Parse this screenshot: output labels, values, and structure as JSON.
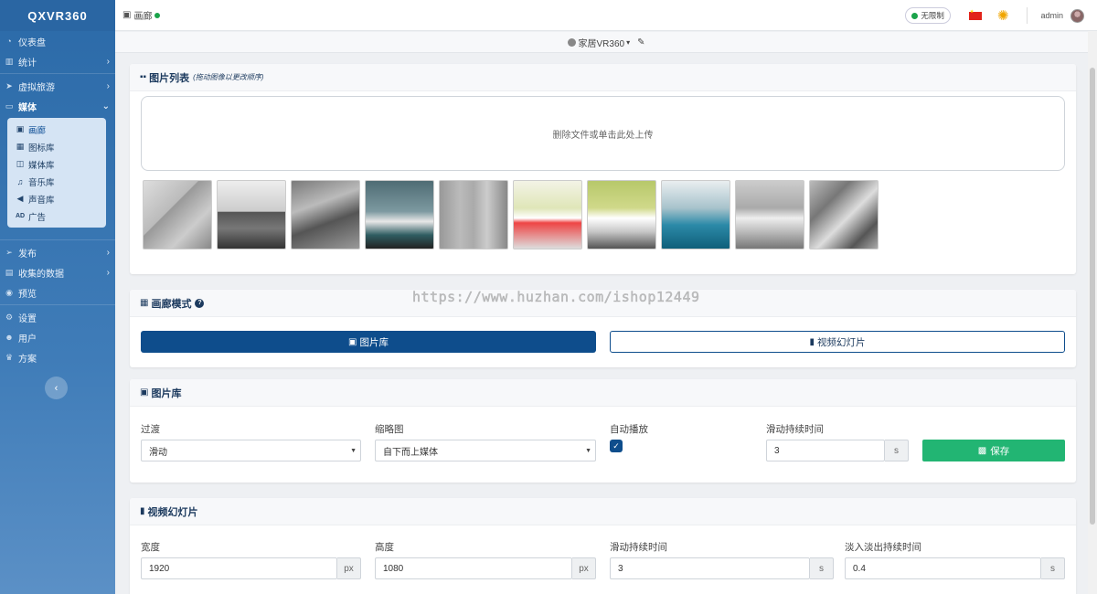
{
  "brand": "QXVR360",
  "sidebar": {
    "items": [
      {
        "label": "仪表盘",
        "icon": "dashboard-icon",
        "glyph": "◔",
        "chevron": false
      },
      {
        "label": "统计",
        "icon": "stats-icon",
        "glyph": "▥",
        "chevron": true
      },
      {
        "label": "虚拟旅游",
        "icon": "tour-icon",
        "glyph": "➤",
        "chevron": true
      },
      {
        "label": "媒体",
        "icon": "monitor-icon",
        "glyph": "▭",
        "chevron": true,
        "active": true
      }
    ],
    "submenu": [
      {
        "label": "画廊",
        "icon": "gallery-icon",
        "glyph": "▣"
      },
      {
        "label": "图标库",
        "icon": "icon-library-icon",
        "glyph": "▦"
      },
      {
        "label": "媒体库",
        "icon": "media-library-icon",
        "glyph": "◫"
      },
      {
        "label": "音乐库",
        "icon": "music-icon",
        "glyph": "♫"
      },
      {
        "label": "声音库",
        "icon": "volume-icon",
        "glyph": "◀)"
      },
      {
        "label": "广告",
        "icon": "ad-icon",
        "glyph": "AD"
      }
    ],
    "items2": [
      {
        "label": "发布",
        "icon": "publish-icon",
        "glyph": "➢",
        "chevron": true
      },
      {
        "label": "收集的数据",
        "icon": "data-icon",
        "glyph": "▤",
        "chevron": true
      },
      {
        "label": "预览",
        "icon": "eye-icon",
        "glyph": "◉",
        "chevron": false
      },
      {
        "label": "设置",
        "icon": "gears-icon",
        "glyph": "⚙",
        "chevron": false
      },
      {
        "label": "用户",
        "icon": "users-icon",
        "glyph": "👥",
        "chevron": false
      },
      {
        "label": "方案",
        "icon": "crown-icon",
        "glyph": "♛",
        "chevron": false
      }
    ]
  },
  "topbar": {
    "page_title": "画廊",
    "plan_badge": "无限制",
    "username": "admin"
  },
  "subbar": {
    "tour_name": "家居VR360"
  },
  "image_list": {
    "title": "图片列表",
    "hint": "(拖动图像以更改顺序)",
    "dropzone_text": "删除文件或单击此处上传",
    "thumb_count": 10
  },
  "gallery_mode": {
    "title": "画廊模式",
    "btn_images": "图片库",
    "btn_video": "视频幻灯片"
  },
  "image_gallery": {
    "title": "图片库",
    "transition_label": "过渡",
    "transition_value": "滑动",
    "thumbnails_label": "缩略图",
    "thumbnails_value": "自下而上媒体",
    "autoplay_label": "自动播放",
    "slide_duration_label": "滑动持续时间",
    "slide_duration_value": "3",
    "unit_s": "s",
    "save_label": "保存"
  },
  "video_slideshow": {
    "title": "视频幻灯片",
    "width_label": "宽度",
    "width_value": "1920",
    "height_label": "高度",
    "height_value": "1080",
    "slide_duration_label": "滑动持续时间",
    "slide_duration_value": "3",
    "fade_label": "淡入淡出持续时间",
    "fade_value": "0.4",
    "unit_px": "px",
    "unit_s": "s"
  },
  "watermark": "https://www.huzhan.com/ishop12449",
  "colors": {
    "primary": "#0e4d8c",
    "success": "#22b573",
    "status_green": "#1aa34a"
  }
}
